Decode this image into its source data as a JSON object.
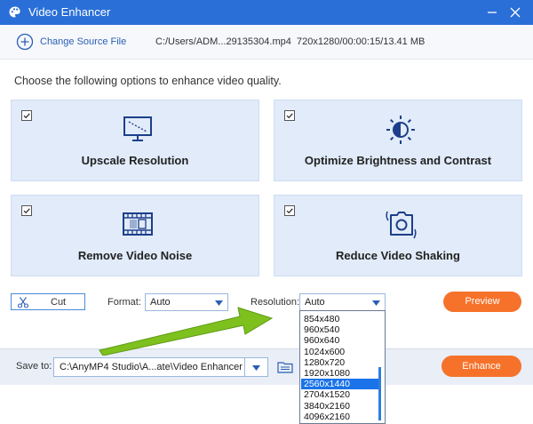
{
  "window": {
    "title": "Video Enhancer"
  },
  "source": {
    "change_label": "Change Source File",
    "path": "C:/Users/ADM...29135304.mp4",
    "info": "720x1280/00:00:15/13.41 MB"
  },
  "instruction": "Choose the following options to enhance video quality.",
  "options": [
    {
      "label": "Upscale Resolution",
      "checked": true,
      "icon": "monitor-icon"
    },
    {
      "label": "Optimize Brightness and Contrast",
      "checked": true,
      "icon": "brightness-icon"
    },
    {
      "label": "Remove Video Noise",
      "checked": true,
      "icon": "film-icon"
    },
    {
      "label": "Reduce Video Shaking",
      "checked": true,
      "icon": "camera-stabilize-icon"
    }
  ],
  "controls": {
    "cut_label": "Cut",
    "format_label": "Format:",
    "format_value": "Auto",
    "resolution_label": "Resolution:",
    "resolution_value": "Auto",
    "preview_label": "Preview"
  },
  "resolution_options": [
    "854x480",
    "960x540",
    "960x640",
    "1024x600",
    "1280x720",
    "1920x1080",
    "2560x1440",
    "2704x1520",
    "3840x2160",
    "4096x2160"
  ],
  "resolution_selected": "2560x1440",
  "save": {
    "label": "Save to:",
    "path": "C:\\AnyMP4 Studio\\A...ate\\Video Enhancer",
    "enhance_label": "Enhance"
  },
  "colors": {
    "titlebar": "#2a6fd8",
    "accent_orange": "#f6722b",
    "option_bg": "#e1ebf9",
    "selection": "#1a73e8",
    "annotation_arrow": "#7ec11f"
  }
}
